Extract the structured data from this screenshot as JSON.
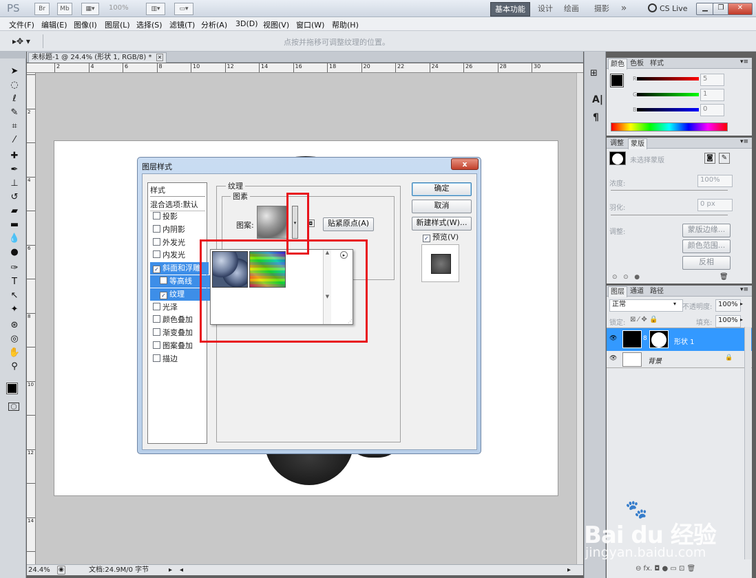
{
  "app": {
    "logo": "PS",
    "title_icons": [
      "Br",
      "Mb"
    ],
    "zoom_title": "100%",
    "workspaces": [
      "基本功能",
      "设计",
      "绘画",
      "摄影"
    ],
    "more": "»",
    "cs_live": "CS Live ▾"
  },
  "menu": [
    "文件(F)",
    "编辑(E)",
    "图像(I)",
    "图层(L)",
    "选择(S)",
    "滤镜(T)",
    "分析(A)",
    "3D(D)",
    "视图(V)",
    "窗口(W)",
    "帮助(H)"
  ],
  "options_bar": {
    "hint": "点按并拖移可调整纹理的位置。"
  },
  "document": {
    "tab_title": "未标题-1 @ 24.4% (形状 1, RGB/8) *",
    "ruler_marks": [
      "2",
      "4",
      "6",
      "8",
      "10",
      "12",
      "14",
      "16",
      "18",
      "20",
      "22",
      "24",
      "26",
      "28",
      "30"
    ],
    "zoom": "24.4%",
    "doc_info": "文档:24.9M/0 字节"
  },
  "color_panel": {
    "tabs": [
      "颜色",
      "色板",
      "样式"
    ],
    "r_label": "R",
    "g_label": "G",
    "b_label": "B",
    "r": "5",
    "g": "1",
    "b": "0"
  },
  "adjust_panel": {
    "tabs": [
      "调整",
      "蒙版"
    ],
    "no_mask": "未选择蒙版",
    "density_label": "浓度:",
    "density": "100%",
    "feather_label": "羽化:",
    "feather": "0 px",
    "refine_label": "调整:",
    "buttons": [
      "蒙版边缘...",
      "颜色范围...",
      "反相"
    ]
  },
  "layers_panel": {
    "tabs": [
      "图层",
      "通道",
      "路径"
    ],
    "blend_mode": "正常",
    "opacity_label": "不透明度:",
    "opacity": "100%",
    "lock_label": "锁定:",
    "fill_label": "填充:",
    "fill": "100%",
    "layers": [
      {
        "name": "形状 1",
        "selected": true
      },
      {
        "name": "背景",
        "selected": false
      }
    ]
  },
  "dialog": {
    "title": "图层样式",
    "close": "x",
    "styles_header": "样式",
    "blend_options": "混合选项:默认",
    "items": [
      {
        "label": "投影",
        "checked": false,
        "sub": false,
        "selected": false
      },
      {
        "label": "内阴影",
        "checked": false,
        "sub": false,
        "selected": false
      },
      {
        "label": "外发光",
        "checked": false,
        "sub": false,
        "selected": false
      },
      {
        "label": "内发光",
        "checked": false,
        "sub": false,
        "selected": false
      },
      {
        "label": "斜面和浮雕",
        "checked": true,
        "sub": false,
        "selected": true
      },
      {
        "label": "等高线",
        "checked": false,
        "sub": true,
        "selected": true
      },
      {
        "label": "纹理",
        "checked": true,
        "sub": true,
        "selected": true
      },
      {
        "label": "光泽",
        "checked": false,
        "sub": false,
        "selected": false
      },
      {
        "label": "颜色叠加",
        "checked": false,
        "sub": false,
        "selected": false
      },
      {
        "label": "渐变叠加",
        "checked": false,
        "sub": false,
        "selected": false
      },
      {
        "label": "图案叠加",
        "checked": false,
        "sub": false,
        "selected": false
      },
      {
        "label": "描边",
        "checked": false,
        "sub": false,
        "selected": false
      }
    ],
    "section_title": "纹理",
    "group_title": "图素",
    "pattern_label": "图案:",
    "snap_origin": "贴紧原点(A)",
    "ok": "确定",
    "cancel": "取消",
    "new_style": "新建样式(W)...",
    "preview_label": "预览(V)",
    "preview_checked": true
  },
  "watermark": {
    "brand": "Bai du 经验",
    "url": "jingyan.baidu.com"
  },
  "colors": {
    "highlight_red": "#e8131b",
    "selection_blue": "#3399ff",
    "accent_blue": "#3d8ee8"
  }
}
